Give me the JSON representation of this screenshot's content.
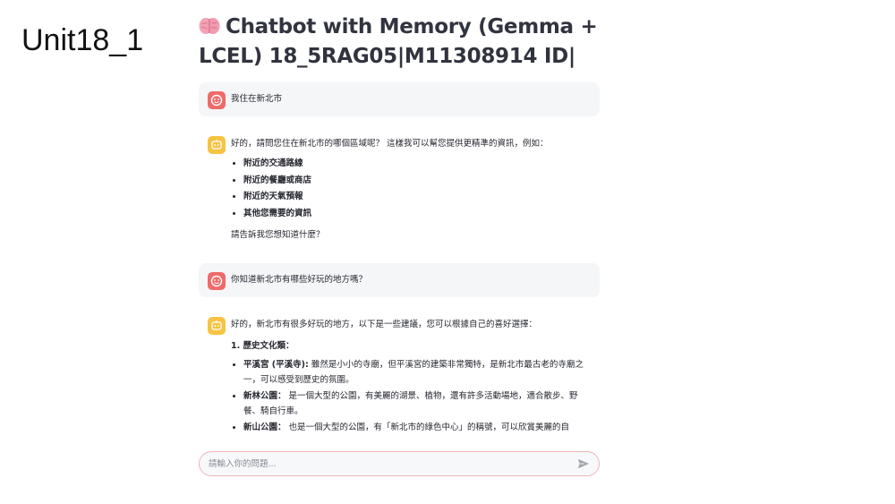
{
  "slide": {
    "label": "Unit18_1"
  },
  "app": {
    "title_line1": "Chatbot with Memory (Gemma +",
    "title_line2": "LCEL) 18_5RAG05|M11308914 ID|"
  },
  "messages": [
    {
      "role": "user",
      "text": "我住在新北市"
    },
    {
      "role": "assistant",
      "intro": "好的，請問您住在新北市的哪個區域呢？ 這樣我可以幫您提供更精準的資訊，例如：",
      "items": [
        "附近的交通路線",
        "附近的餐廳或商店",
        "附近的天氣預報",
        "其他您需要的資訊"
      ],
      "outro": "請告訴我您想知道什麼？"
    },
    {
      "role": "user",
      "text": "你知道新北市有哪些好玩的地方嗎？"
    },
    {
      "role": "assistant",
      "intro": "好的，新北市有很多好玩的地方，以下是一些建議，您可以根據自己的喜好選擇：",
      "section_title": "1. 歷史文化類：",
      "places": [
        {
          "name": "平溪宮 (平溪寺):",
          "desc": " 雖然是小小的寺廟，但平溪宮的建築非常獨特，是新北市最古老的寺廟之一，可以感受到歷史的氛圍。"
        },
        {
          "name": "新林公園：",
          "desc": " 是一個大型的公園，有美麗的湖景、植物，還有許多活動場地，適合散步、野餐、騎自行車。"
        },
        {
          "name": "新山公園：",
          "desc": " 也是一個大型的公園，有「新北市的綠色中心」的稱號，可以欣賞美麗的自"
        }
      ]
    }
  ],
  "input": {
    "placeholder": "請輸入你的問題..."
  },
  "icons": {
    "title_icon": "brain-icon",
    "user_avatar": "user-avatar-icon",
    "bot_avatar": "bot-avatar-icon",
    "send": "send-icon"
  },
  "colors": {
    "user_avatar": "#ef6a6a",
    "bot_avatar": "#f7c344",
    "input_border": "#f0b4b8"
  }
}
